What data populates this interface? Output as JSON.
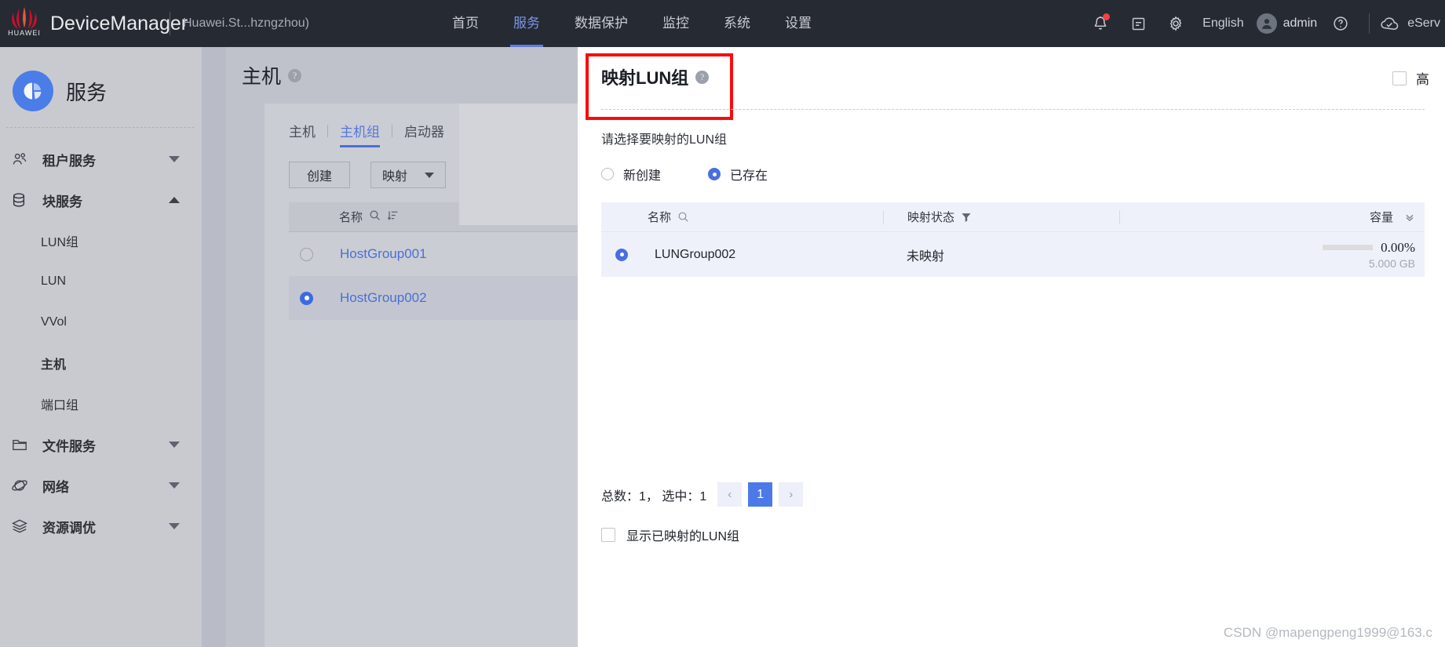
{
  "topbar": {
    "brand": "DeviceManager",
    "device_name": "Huawei.St...hzngzhou)",
    "nav": [
      {
        "label": "首页",
        "active": false
      },
      {
        "label": "服务",
        "active": true
      },
      {
        "label": "数据保护",
        "active": false
      },
      {
        "label": "监控",
        "active": false
      },
      {
        "label": "系统",
        "active": false
      },
      {
        "label": "设置",
        "active": false
      }
    ],
    "language": "English",
    "user": "admin",
    "eservice": "eServ",
    "logo_text": "HUAWEI"
  },
  "sidebar": {
    "title": "服务",
    "items": [
      {
        "label": "租户服务",
        "icon": "users-icon",
        "type": "group",
        "expanded": false
      },
      {
        "label": "块服务",
        "icon": "database-icon",
        "type": "group",
        "expanded": true
      },
      {
        "label": "LUN组",
        "icon": "",
        "type": "sub",
        "active": false
      },
      {
        "label": "LUN",
        "icon": "",
        "type": "sub",
        "active": false
      },
      {
        "label": "VVol",
        "icon": "",
        "type": "sub",
        "active": false
      },
      {
        "label": "主机",
        "icon": "",
        "type": "sub",
        "active": true
      },
      {
        "label": "端口组",
        "icon": "",
        "type": "sub",
        "active": false
      },
      {
        "label": "文件服务",
        "icon": "folder-icon",
        "type": "group",
        "expanded": false
      },
      {
        "label": "网络",
        "icon": "network-icon",
        "type": "group",
        "expanded": false
      },
      {
        "label": "资源调优",
        "icon": "layers-icon",
        "type": "group",
        "expanded": false
      }
    ]
  },
  "page": {
    "title": "主机",
    "tabs": [
      {
        "label": "主机",
        "active": false
      },
      {
        "label": "主机组",
        "active": true
      },
      {
        "label": "启动器",
        "active": false
      }
    ],
    "buttons": {
      "create": "创建",
      "map": "映射"
    },
    "table": {
      "header_name": "名称",
      "rows": [
        {
          "name": "HostGroup001",
          "selected": false
        },
        {
          "name": "HostGroup002",
          "selected": true
        }
      ]
    }
  },
  "panel": {
    "title": "映射LUN组",
    "advanced_checkbox": "高",
    "subtitle": "请选择要映射的LUN组",
    "radios": [
      {
        "label": "新创建",
        "selected": false
      },
      {
        "label": "已存在",
        "selected": true
      }
    ],
    "table": {
      "columns": {
        "name": "名称",
        "status": "映射状态",
        "capacity": "容量"
      },
      "rows": [
        {
          "name": "LUNGroup002",
          "status": "未映射",
          "capacity_percent": "0.00%",
          "capacity_size": "5.000 GB",
          "capacity_fill": 0
        }
      ]
    },
    "pagination": {
      "summary": "总数：1，  选中：1",
      "prev": "‹",
      "current_page": "1",
      "next": "›"
    },
    "show_mapped_checkbox": "显示已映射的LUN组"
  },
  "watermark": "CSDN @mapengpeng1999@163.c",
  "colors": {
    "accent": "#4b7ae8",
    "topbar_bg": "#262a33",
    "sidebar_bg": "#c9cad0",
    "highlight_red": "#fa0c0c",
    "table_row_bg": "#eff1fa"
  }
}
